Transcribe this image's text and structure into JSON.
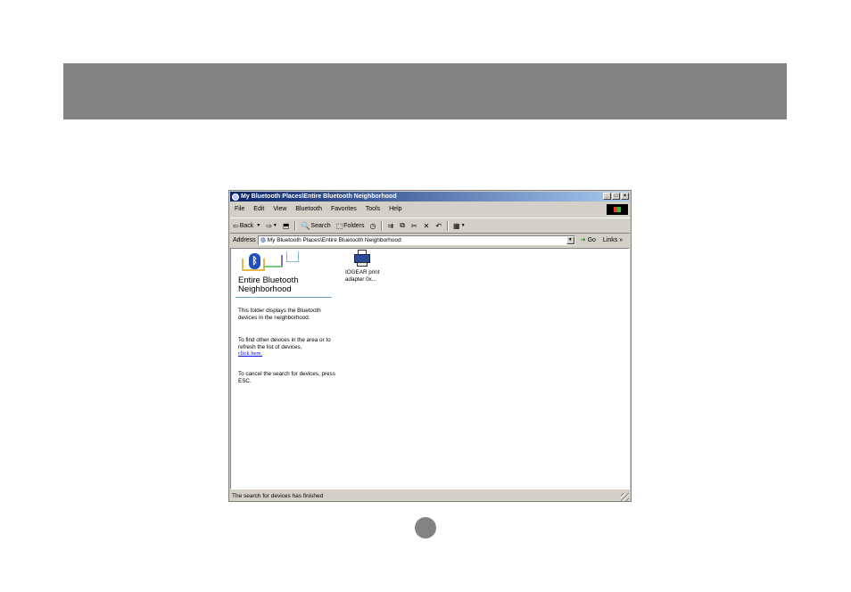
{
  "window": {
    "title": "My Bluetooth Places\\Entire Bluetooth Neighborhood",
    "controls": [
      "_",
      "□",
      "×"
    ]
  },
  "menu": [
    "File",
    "Edit",
    "View",
    "Bluetooth",
    "Favorites",
    "Tools",
    "Help"
  ],
  "toolbar": {
    "back": "Back",
    "search": "Search",
    "folders": "Folders"
  },
  "address": {
    "label": "Address",
    "value": "My Bluetooth Places\\Entire Bluetooth Neighborhood",
    "go": "Go",
    "links": "Links"
  },
  "panel": {
    "title": "Entire Bluetooth Neighborhood",
    "text1": "This folder displays the Bluetooth devices in the neighborhood.",
    "text2": "To find other devices in the area or to refresh the list of devices,",
    "link": "click here.",
    "text3": "To cancel the search for devices, press ESC."
  },
  "device": {
    "icon": "printer-icon",
    "label": "IOGEAR print adapter 0x..."
  },
  "status": "The search for devices has finished",
  "colors": {
    "banner": "#818283",
    "titlebar_start": "#0a246a",
    "titlebar_end": "#a6caf0",
    "window_bg": "#d4d0c8"
  }
}
